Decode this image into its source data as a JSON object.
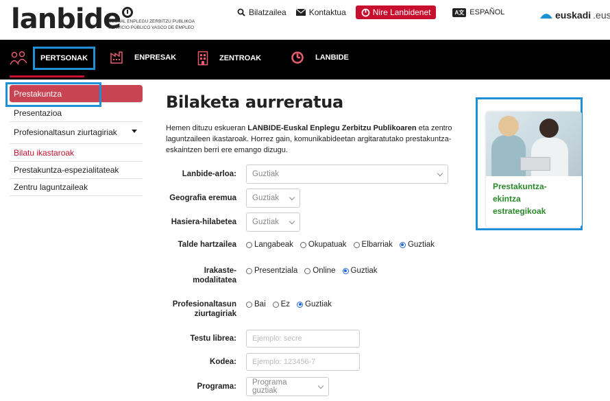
{
  "header": {
    "logo_text": "lanbide",
    "logo_sub_1": "EUSKAL ENPLEGU ZERBITZU PUBLIKOA",
    "logo_sub_2": "SERVICIO PÚBLICO VASCO DE EMPLEO",
    "search_label": "Bilatzailea",
    "contact_label": "Kontaktua",
    "nire_label": "Nire Lanbidenet",
    "lang_badge": "A文",
    "lang_label": "ESPAÑOL",
    "euskadi_bold": "euskadi",
    "euskadi_suffix": ".eus"
  },
  "nav": {
    "items": [
      {
        "label": "PERTSONAK"
      },
      {
        "label": "ENPRESAK"
      },
      {
        "label": "ZENTROAK"
      },
      {
        "label": "LANBIDE"
      }
    ]
  },
  "sidebar": {
    "items": [
      {
        "label": "Prestakuntza"
      },
      {
        "label": "Presentazioa"
      },
      {
        "label": "Profesionaltasun ziurtagiriak"
      },
      {
        "label": "Bilatu ikastaroak"
      },
      {
        "label": "Prestakuntza-espezialitateak"
      },
      {
        "label": "Zentru laguntzaileak"
      }
    ]
  },
  "main": {
    "title": "Bilaketa aurreratua",
    "intro_1": "Hemen dituzu eskueran ",
    "intro_bold": "LANBIDE-Euskal Enplegu Zerbitzu Publikoaren",
    "intro_2": " eta zentro laguntzaileen ikastaroak. Horrez gain, komunikabideetan argitaratutako prestakuntza-eskaintzen berri ere emango dizugu."
  },
  "form": {
    "arloa_label": "Lanbide-arloa:",
    "arloa_value": "Guztiak",
    "geografia_label": "Geografia eremua",
    "geografia_value": "Guztiak",
    "hasiera_label": "Hasiera-hilabetea",
    "hasiera_value": "Guztiak",
    "talde_label": "Talde hartzailea",
    "talde_options": [
      "Langabeak",
      "Okupatuak",
      "Elbarriak",
      "Guztiak"
    ],
    "talde_selected": "Guztiak",
    "modalitatea_label_1": "Irakaste-",
    "modalitatea_label_2": "modalitatea",
    "modalitatea_options": [
      "Presentziala",
      "Online",
      "Guztiak"
    ],
    "modalitatea_selected": "Guztiak",
    "ziurtagiri_label_1": "Profesionaltasun",
    "ziurtagiri_label_2": "ziurtagiriak",
    "ziurtagiri_options": [
      "Bai",
      "Ez",
      "Guztiak"
    ],
    "ziurtagiri_selected": "Guztiak",
    "testu_label": "Testu librea:",
    "testu_placeholder": "Ejemplo: secre",
    "kodea_label": "Kodea:",
    "kodea_placeholder": "Ejemplo: 123456-7",
    "programa_label": "Programa:",
    "programa_value": "Programa guztiak"
  },
  "promo": {
    "line_1": "Prestakuntza-",
    "line_2": "ekintza",
    "line_3": "estrategikoak"
  },
  "colors": {
    "brand_red": "#c8102e",
    "sidebar_active": "#c84452",
    "highlight_blue": "#1e90d6",
    "promo_green": "#2a8a2a"
  }
}
